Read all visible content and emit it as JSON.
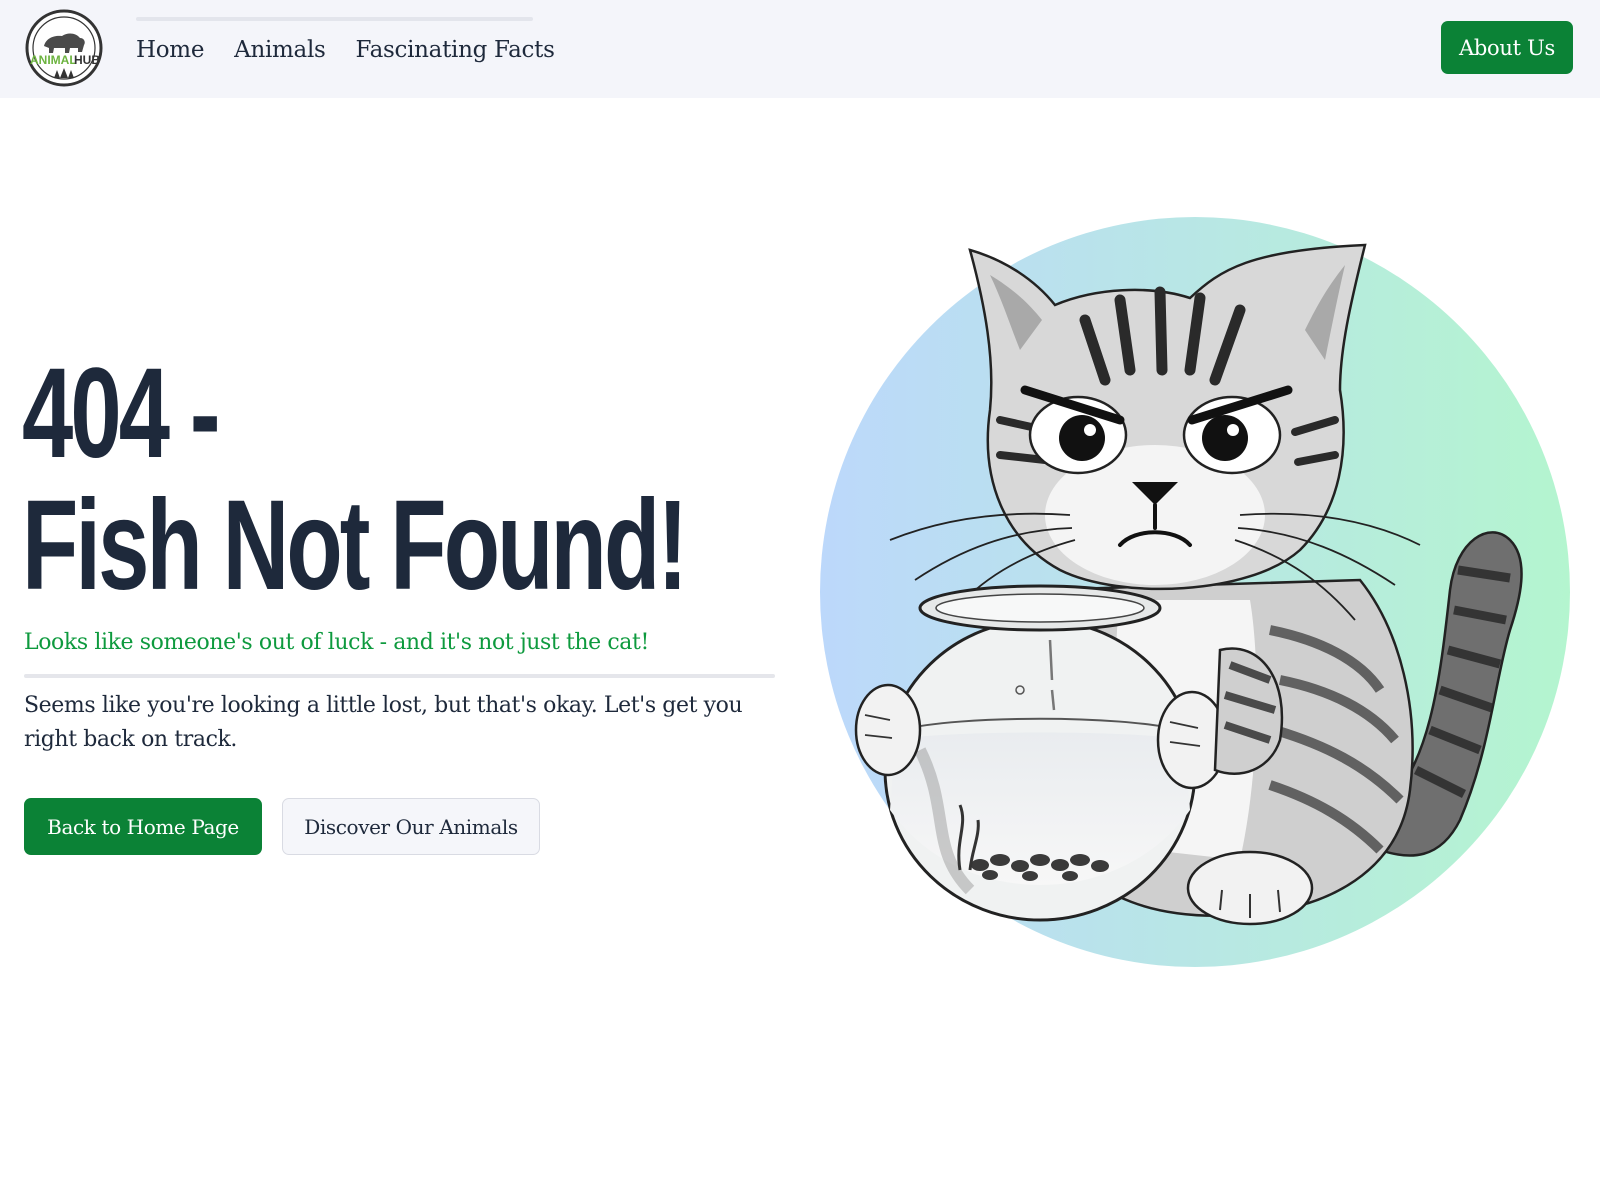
{
  "header": {
    "logo": {
      "icon": "animal-hub-logo-icon",
      "text_left": "ANIMAL",
      "text_right": "HUB",
      "text_left_color": "#6cb33f"
    },
    "nav": [
      {
        "label": "Home"
      },
      {
        "label": "Animals"
      },
      {
        "label": "Fascinating Facts"
      }
    ],
    "about_button": "About Us"
  },
  "hero": {
    "title_line1": "404 -",
    "title_line2": "Fish Not Found!",
    "subtitle": "Looks like someone's out of luck - and it's not just the cat!",
    "description": "Seems like you're looking a little lost, but that's okay. Let's get you right back on track.",
    "primary_button": "Back to Home Page",
    "secondary_button": "Discover Our Animals"
  },
  "illustration": {
    "subject": "angry-cat-with-fishbowl-icon"
  },
  "colors": {
    "primary_green": "#0b8236",
    "subtitle_green": "#0e9a3e",
    "heading_dark": "#1e293b",
    "header_bg": "#f4f5fa",
    "circle_gradient_start": "#bcd8fb",
    "circle_gradient_end": "#b4f5cf"
  }
}
